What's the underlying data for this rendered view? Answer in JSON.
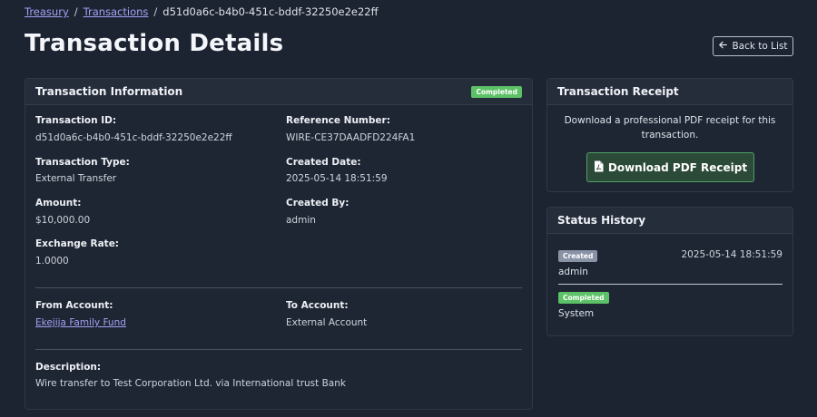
{
  "breadcrumb": {
    "items": [
      "Treasury",
      "Transactions"
    ],
    "current": "d51d0a6c-b4b0-451c-bddf-32250e2e22ff"
  },
  "page": {
    "title": "Transaction Details",
    "back_label": "Back to List"
  },
  "info": {
    "title": "Transaction Information",
    "status": "Completed",
    "transaction_id": {
      "label": "Transaction ID:",
      "value": "d51d0a6c-b4b0-451c-bddf-32250e2e22ff"
    },
    "reference_number": {
      "label": "Reference Number:",
      "value": "WIRE-CE37DAADFD224FA1"
    },
    "transaction_type": {
      "label": "Transaction Type:",
      "value": "External Transfer"
    },
    "created_date": {
      "label": "Created Date:",
      "value": "2025-05-14 18:51:59"
    },
    "amount": {
      "label": "Amount:",
      "value": "$10,000.00"
    },
    "created_by": {
      "label": "Created By:",
      "value": "admin"
    },
    "exchange_rate": {
      "label": "Exchange Rate:",
      "value": "1.0000"
    },
    "from_account": {
      "label": "From Account:",
      "value": "Ekejija Family Fund"
    },
    "to_account": {
      "label": "To Account:",
      "value": "External Account"
    },
    "description": {
      "label": "Description:",
      "value": "Wire transfer to Test Corporation Ltd. via International trust Bank"
    }
  },
  "receipt": {
    "title": "Transaction Receipt",
    "text": "Download a professional PDF receipt for this transaction.",
    "button_label": "Download PDF Receipt",
    "icon": "file-pdf-icon"
  },
  "history": {
    "title": "Status History",
    "entries": [
      {
        "status": "Created",
        "date": "2025-05-14 18:51:59",
        "user": "admin"
      },
      {
        "status": "Completed",
        "date": "",
        "user": "System"
      }
    ]
  },
  "colors": {
    "background": "#1c2331",
    "card": "#1e2634",
    "card_header": "#252d3b",
    "link": "#a6a1f5",
    "success": "#5cc167",
    "neutral_badge": "#8a93a6",
    "download_button": "#2c4a38"
  }
}
